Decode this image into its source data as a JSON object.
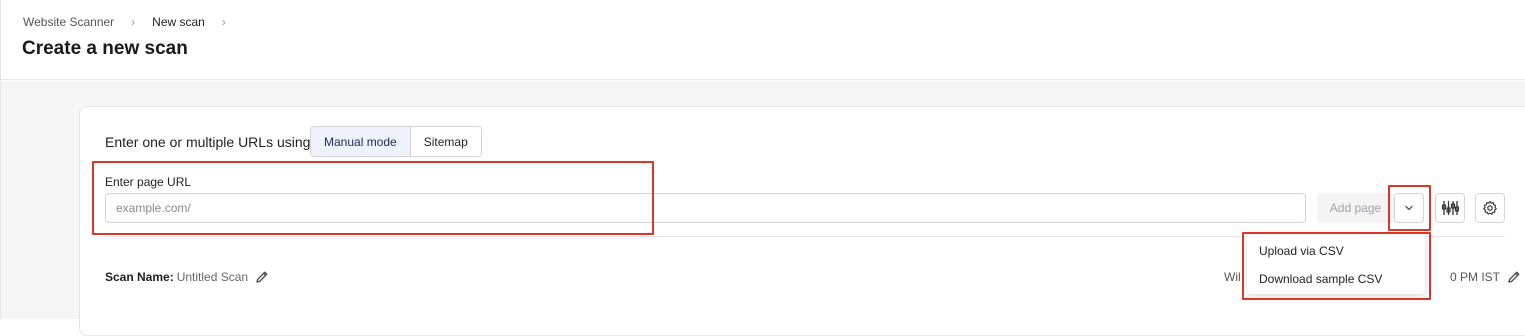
{
  "breadcrumb": {
    "items": [
      "Website Scanner",
      "New scan"
    ],
    "separator": "›"
  },
  "page": {
    "title": "Create a new scan"
  },
  "mode": {
    "label": "Enter one or multiple URLs using",
    "options": [
      "Manual mode",
      "Sitemap"
    ],
    "selected": "Manual mode"
  },
  "url_field": {
    "label": "Enter page URL",
    "placeholder": "example.com/",
    "value": ""
  },
  "actions": {
    "add_page": "Add page"
  },
  "icons": {
    "dropdown": "chevron-down-icon",
    "filter": "sliders-icon",
    "settings": "gear-icon",
    "edit": "pencil-icon"
  },
  "scan": {
    "name_key": "Scan Name:",
    "name_value": "Untitled Scan",
    "schedule_left": "Wil",
    "schedule_right": "0 PM IST"
  },
  "dropdown_menu": {
    "items": [
      "Upload via CSV",
      "Download sample CSV"
    ]
  },
  "colors": {
    "highlight": "#d9372a",
    "active_mode_bg": "#eef2fb"
  }
}
